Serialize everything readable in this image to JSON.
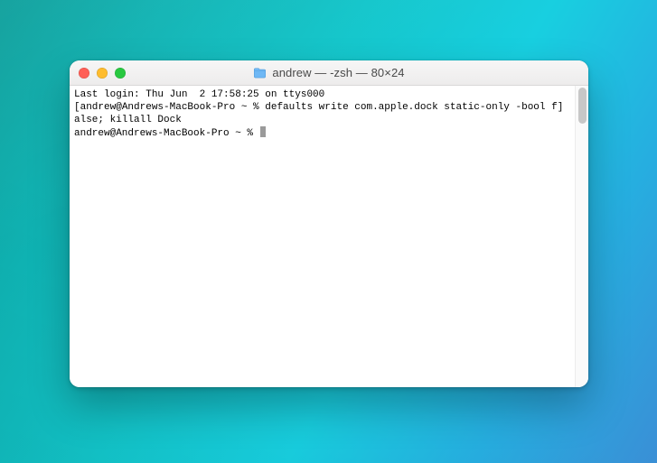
{
  "window": {
    "title": "andrew — -zsh — 80×24"
  },
  "terminal": {
    "line1": "Last login: Thu Jun  2 17:58:25 on ttys000",
    "line2_prefix": "[",
    "line2_prompt": "andrew@Andrews-MacBook-Pro ~ % ",
    "line2_cmd_part1": "defaults write com.apple.dock static-only -bool f",
    "line2_suffix": "]",
    "line3": "alse; killall Dock",
    "line4_prompt": "andrew@Andrews-MacBook-Pro ~ % "
  }
}
